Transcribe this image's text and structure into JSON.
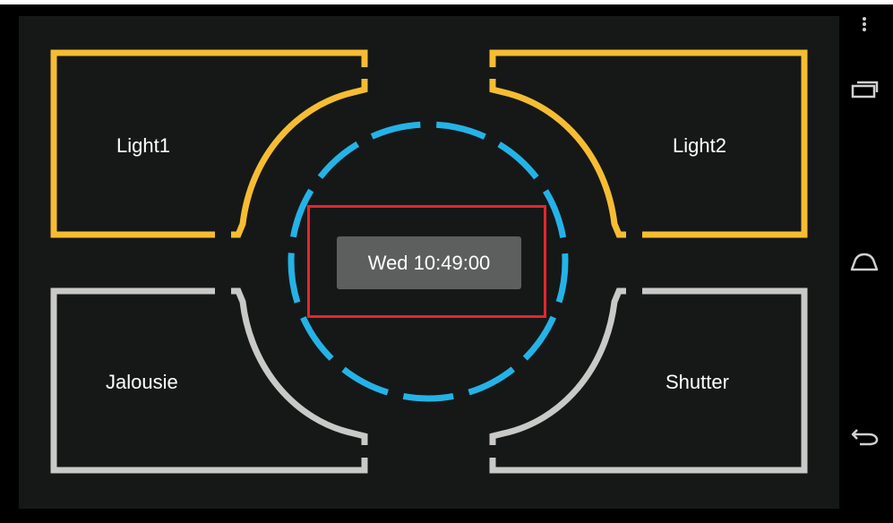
{
  "colors": {
    "background": "#161818",
    "active_tile": "#f6bd33",
    "inactive_tile": "#c9c9c7",
    "ring": "#24b3e7",
    "clock_bg": "#5d5f5f",
    "highlight": "#e3262d"
  },
  "tiles": {
    "top_left": {
      "label": "Light1",
      "state": "on"
    },
    "top_right": {
      "label": "Light2",
      "state": "on"
    },
    "bottom_left": {
      "label": "Jalousie",
      "state": "off"
    },
    "bottom_right": {
      "label": "Shutter",
      "state": "off"
    }
  },
  "clock": {
    "text": "Wed 10:49:00"
  },
  "nav_bar": {
    "menu_icon": "overflow-menu-icon",
    "recents_icon": "recent-apps-icon",
    "home_icon": "home-icon",
    "back_icon": "back-icon"
  }
}
